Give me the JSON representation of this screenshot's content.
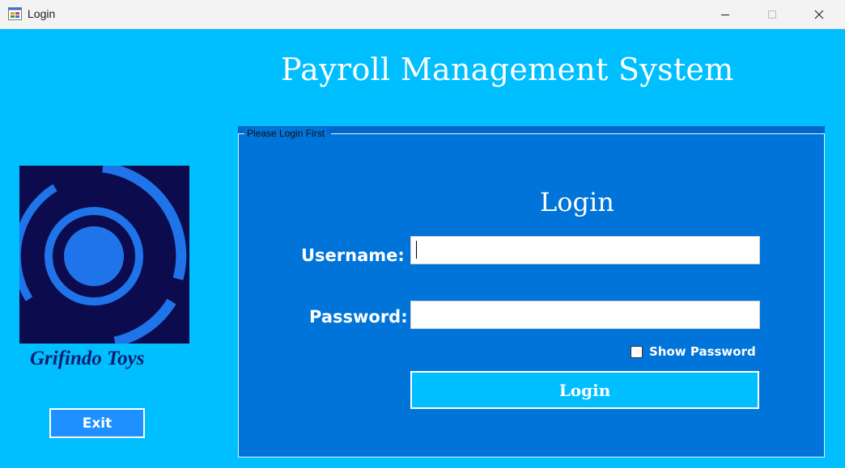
{
  "window": {
    "title": "Login",
    "icon": "app-window-icon",
    "controls": [
      "minimize-icon",
      "maximize-icon",
      "close-icon"
    ]
  },
  "app": {
    "title": "Payroll Management System"
  },
  "brand": {
    "name": "Grifindo Toys",
    "logo_icon": "concentric-rings-logo"
  },
  "exit_button": {
    "label": "Exit"
  },
  "login_group": {
    "legend": "Please Login First",
    "heading": "Login",
    "username_label": "Username:",
    "username_value": "",
    "password_label": "Password:",
    "password_value": "",
    "show_password_label": "Show Password",
    "show_password_checked": false,
    "login_button_label": "Login"
  },
  "colors": {
    "background": "#00BFFF",
    "panel": "#0074D9",
    "logo_bg": "#0B0B4E",
    "logo_accent": "#1E74E8",
    "brand_text": "#0B1E6E"
  }
}
